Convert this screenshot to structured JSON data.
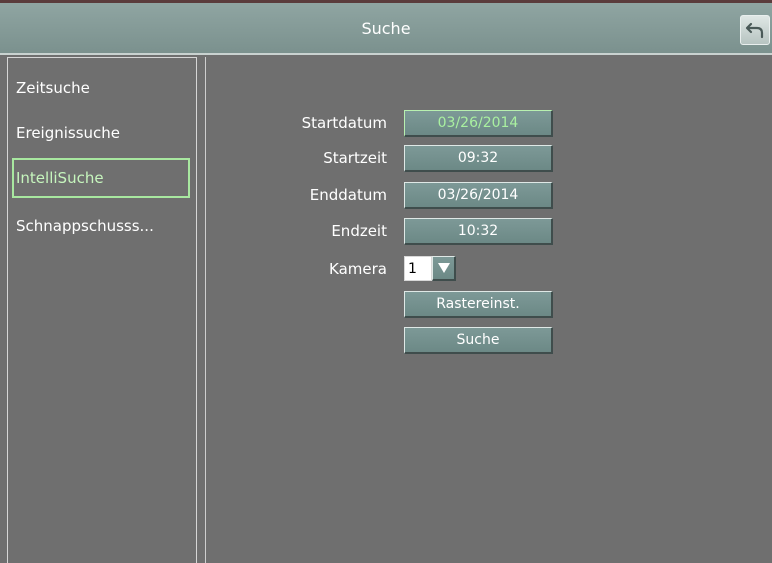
{
  "header": {
    "title": "Suche",
    "back_icon": "return-arrow-icon"
  },
  "sidebar": {
    "items": [
      {
        "label": "Zeitsuche",
        "selected": false
      },
      {
        "label": "Ereignissuche",
        "selected": false
      },
      {
        "label": "IntelliSuche",
        "selected": true
      },
      {
        "label": "Schnappschusss...",
        "selected": false
      }
    ]
  },
  "form": {
    "start_date_label": "Startdatum",
    "start_date_value": "03/26/2014",
    "start_time_label": "Startzeit",
    "start_time_value": "09:32",
    "end_date_label": "Enddatum",
    "end_date_value": "03/26/2014",
    "end_time_label": "Endzeit",
    "end_time_value": "10:32",
    "camera_label": "Kamera",
    "camera_value": "1",
    "grid_button_label": "Rastereinst.",
    "search_button_label": "Suche"
  },
  "colors": {
    "background": "#6f6f6f",
    "titlebar": "#869c99",
    "button": "#76928f",
    "selected_accent": "#a8e8a0"
  }
}
